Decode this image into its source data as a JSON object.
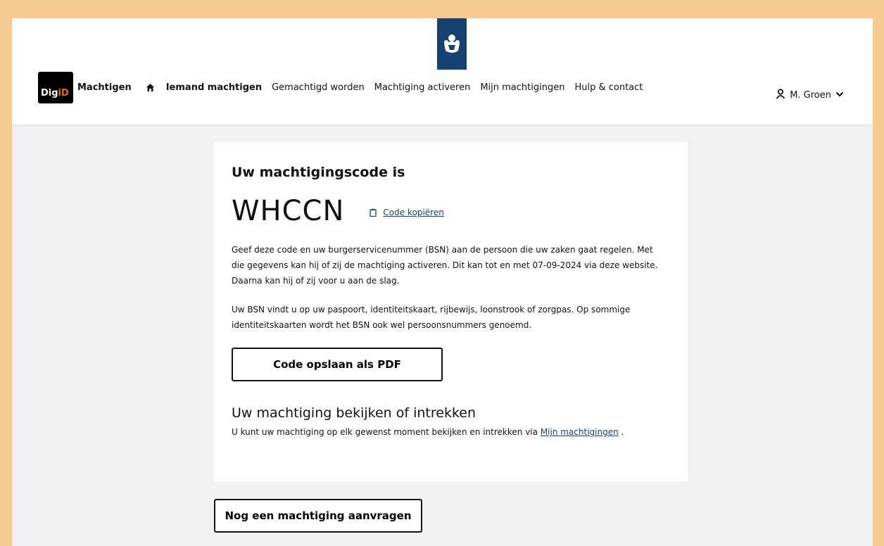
{
  "header": {
    "logo_text_1": "Dig",
    "logo_text_2": "iD",
    "app_name": "Machtigen",
    "nav": [
      {
        "label": "Iemand machtigen"
      },
      {
        "label": "Gemachtigd worden"
      },
      {
        "label": "Machtiging activeren"
      },
      {
        "label": "Mijn machtigingen"
      },
      {
        "label": "Hulp & contact"
      }
    ],
    "user_name": "M. Groen",
    "icons": [
      "emblem-icon",
      "home-icon",
      "user-icon",
      "chevron-down-icon"
    ]
  },
  "card": {
    "title": "Uw machtigingscode is",
    "code": "WHCCN",
    "copy_label": "Code kopiëren",
    "paragraph1": "Geef deze code en uw burgerservicenummer (BSN) aan de persoon die uw zaken gaat regelen. Met die gegevens kan hij of zij de machtiging activeren. Dit kan tot en met 07-09-2024 via deze website. Daarna kan hij of zij voor u aan de slag.",
    "paragraph2": "Uw BSN vindt u op uw paspoort, identiteitskaart, rijbewijs, loonstrook of zorgpas. Op sommige identiteitskaarten wordt het BSN ook wel persoonsnummers genoemd.",
    "pdf_button": "Code opslaan als PDF",
    "subtitle": "Uw machtiging bekijken of intrekken",
    "small_text": "U kunt uw machtiging op elk gewenst moment bekijken en intrekken via",
    "small_link": "Mijn machtigingen",
    "small_end": "."
  },
  "another_button": "Nog een machtiging aanvragen",
  "colors": {
    "brand": "#154273",
    "digid_accent": "#e17000",
    "border": "#f6c990"
  }
}
